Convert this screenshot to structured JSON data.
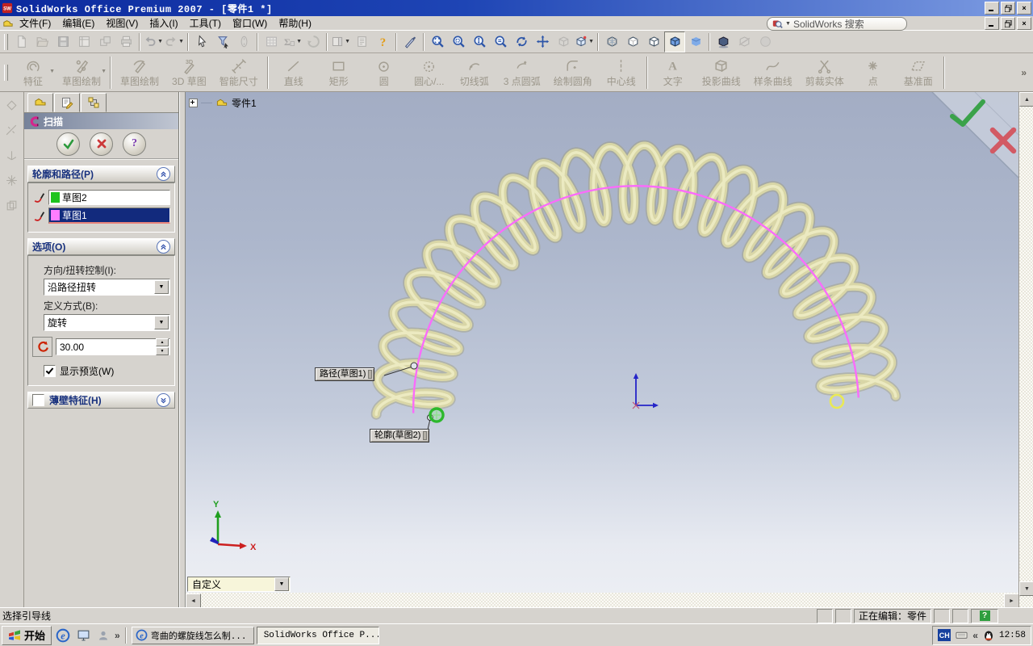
{
  "window": {
    "title": "SolidWorks Office Premium 2007 - [零件1 *]"
  },
  "menu": {
    "items": [
      "文件(F)",
      "编辑(E)",
      "视图(V)",
      "插入(I)",
      "工具(T)",
      "窗口(W)",
      "帮助(H)"
    ],
    "search_label": "SolidWorks 搜索"
  },
  "toolbar_main": {
    "groups": [
      {
        "items": [
          {
            "name": "new",
            "dis": true
          },
          {
            "name": "open",
            "dis": true
          },
          {
            "name": "save",
            "dis": true
          },
          {
            "name": "make-drawing",
            "dis": true
          },
          {
            "name": "make-assembly",
            "dis": true
          },
          {
            "name": "print",
            "dis": true
          }
        ]
      },
      {
        "items": [
          {
            "name": "undo",
            "dd": true,
            "dis": true
          },
          {
            "name": "redo",
            "dd": true,
            "dis": true
          }
        ]
      },
      {
        "items": [
          {
            "name": "select"
          },
          {
            "name": "selection-filter"
          },
          {
            "name": "select-other",
            "dis": true
          }
        ]
      },
      {
        "items": [
          {
            "name": "sketch-grid",
            "dis": true
          },
          {
            "name": "equations",
            "dd": true,
            "dis": true
          },
          {
            "name": "rebuild",
            "dis": true
          }
        ]
      },
      {
        "items": [
          {
            "name": "task-pane",
            "dd": true,
            "dis": true
          },
          {
            "name": "options",
            "dis": true
          },
          {
            "name": "help"
          }
        ]
      },
      {
        "items": [
          {
            "name": "reference-pointer"
          }
        ]
      },
      {
        "items": [
          {
            "name": "zoom-fit"
          },
          {
            "name": "zoom-area"
          },
          {
            "name": "zoom-in-out"
          },
          {
            "name": "zoom-selection"
          },
          {
            "name": "rotate-view"
          },
          {
            "name": "pan"
          },
          {
            "name": "view-3d",
            "dis": true
          },
          {
            "name": "view-orientation",
            "dd": true
          }
        ]
      },
      {
        "items": [
          {
            "name": "wireframe"
          },
          {
            "name": "hidden-lines-visible"
          },
          {
            "name": "hidden-lines-removed"
          },
          {
            "name": "shaded-with-edges",
            "sel": true
          },
          {
            "name": "shaded"
          }
        ]
      },
      {
        "items": [
          {
            "name": "shadows"
          },
          {
            "name": "section-view",
            "dis": true
          },
          {
            "name": "realview",
            "dis": true
          }
        ]
      }
    ]
  },
  "toolbar_features": {
    "items": [
      {
        "label": "特征",
        "icon": "feature",
        "dd": true
      },
      {
        "label": "草图绘制",
        "icon": "sketch",
        "dd": true
      },
      {
        "sep": true
      },
      {
        "label": "草图绘制",
        "icon": "sketch2"
      },
      {
        "label": "3D 草图",
        "icon": "sketch3d"
      },
      {
        "label": "智能尺寸",
        "icon": "smartdim"
      },
      {
        "sep": true
      },
      {
        "label": "直线",
        "icon": "line"
      },
      {
        "label": "矩形",
        "icon": "rectangle"
      },
      {
        "label": "圆",
        "icon": "circle"
      },
      {
        "label": "圆心/...",
        "icon": "perimeter-circle"
      },
      {
        "label": "切线弧",
        "icon": "tangent-arc"
      },
      {
        "label": "3 点圆弧",
        "icon": "three-point-arc"
      },
      {
        "label": "绘制圆角",
        "icon": "sketch-fillet"
      },
      {
        "label": "中心线",
        "icon": "centerline"
      },
      {
        "sep": true
      },
      {
        "label": "文字",
        "icon": "sketch-text"
      },
      {
        "label": "投影曲线",
        "icon": "projected-curve"
      },
      {
        "label": "样条曲线",
        "icon": "spline"
      },
      {
        "label": "剪裁实体",
        "icon": "trim"
      },
      {
        "label": "点",
        "icon": "point"
      },
      {
        "label": "基准面",
        "icon": "plane"
      },
      {
        "sep": true
      }
    ],
    "overflow": "»"
  },
  "property_manager": {
    "title": "扫描",
    "profile_path": {
      "title": "轮廓和路径(P)",
      "rows": [
        {
          "value": "草图2",
          "swatch": "#1ec41e",
          "selected": false
        },
        {
          "value": "草图1",
          "swatch": "#ff7dff",
          "selected": true
        }
      ]
    },
    "options": {
      "title": "选项(O)",
      "orientation_label": "方向/扭转控制(I):",
      "orientation_value": "沿路径扭转",
      "define_label": "定义方式(B):",
      "define_value": "旋转",
      "angle_value": "30.00",
      "preview_label": "显示预览(W)",
      "preview_checked": true
    },
    "thin_feature": {
      "title": "薄壁特征(H)",
      "checked": false
    }
  },
  "viewport": {
    "part_label": "零件1",
    "path_callout": "路径(草图1)",
    "profile_callout": "轮廓(草图2)",
    "view_combo": "自定义",
    "axis_x": "X",
    "axis_y": "Y",
    "colors": {
      "path": "#fa6cfa",
      "coil": "#dbd8a6",
      "coil_shadow": "#9e9b79",
      "profile_marker": "#2db82d",
      "end_marker": "#e9e955",
      "origin": "#2424c8"
    }
  },
  "statusbar": {
    "message": "选择引导线",
    "mode": "正在编辑：零件",
    "help": "?"
  },
  "taskbar": {
    "start_label": "开始",
    "tasks": [
      {
        "label": "弯曲的螺旋线怎么制...",
        "icon": "ie",
        "active": false
      },
      {
        "label": "SolidWorks Office P...",
        "icon": "sw",
        "active": true
      }
    ],
    "tray": {
      "ime": "CH",
      "collapse": "«",
      "time": "12:58"
    }
  }
}
